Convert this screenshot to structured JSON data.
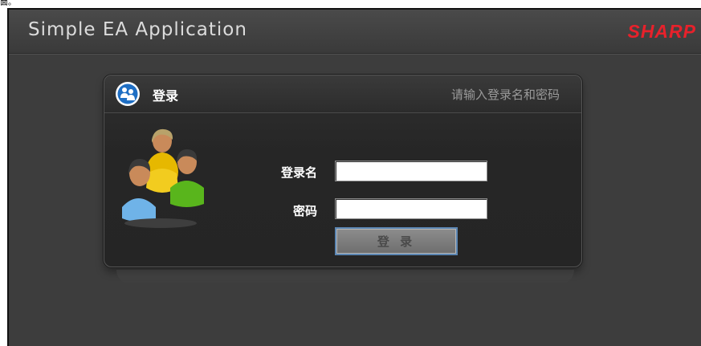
{
  "page_fragment": "面。",
  "header": {
    "title": "Simple EA Application",
    "brand": "SHARP",
    "brand_color": "#e8212b"
  },
  "login_panel": {
    "title": "登录",
    "hint": "请输入登录名和密码",
    "header_icon": "users-group-icon",
    "illustration": "users-group-illustration",
    "username_label": "登录名",
    "username_value": "",
    "password_label": "密码",
    "password_value": "",
    "submit_label": "登 录"
  }
}
